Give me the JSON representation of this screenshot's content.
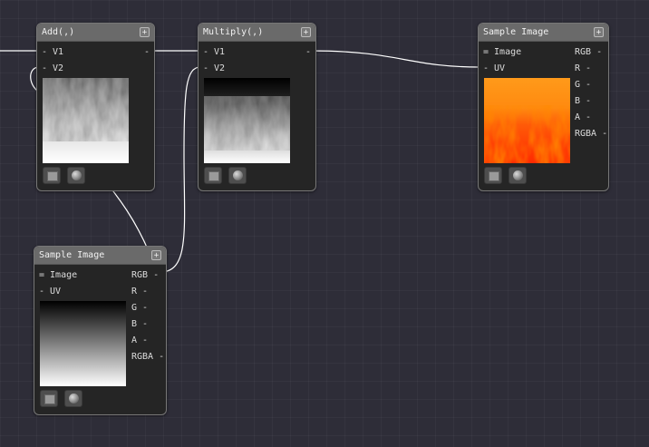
{
  "nodes": {
    "add": {
      "title": "Add(,)",
      "plus": "+",
      "inputs": [
        "- V1",
        "- V2"
      ],
      "output": "-"
    },
    "multiply": {
      "title": "Multiply(,)",
      "plus": "+",
      "inputs": [
        "- V1",
        "- V2"
      ],
      "output": "-"
    },
    "sample_fire": {
      "title": "Sample Image",
      "plus": "+",
      "inputs": [
        "= Image",
        "- UV"
      ],
      "outputs": [
        "RGB -",
        "R -",
        "G -",
        "B -",
        "A -",
        "RGBA -"
      ]
    },
    "sample_gradient": {
      "title": "Sample Image",
      "plus": "+",
      "inputs": [
        "= Image",
        "- UV"
      ],
      "outputs": [
        "RGB -",
        "R -",
        "G -",
        "B -",
        "A -",
        "RGBA -"
      ]
    }
  },
  "colors": {
    "background": "#2e2d38",
    "node_body": "#252525",
    "node_header": "#6a6a6a",
    "wire": "#ffffff"
  }
}
